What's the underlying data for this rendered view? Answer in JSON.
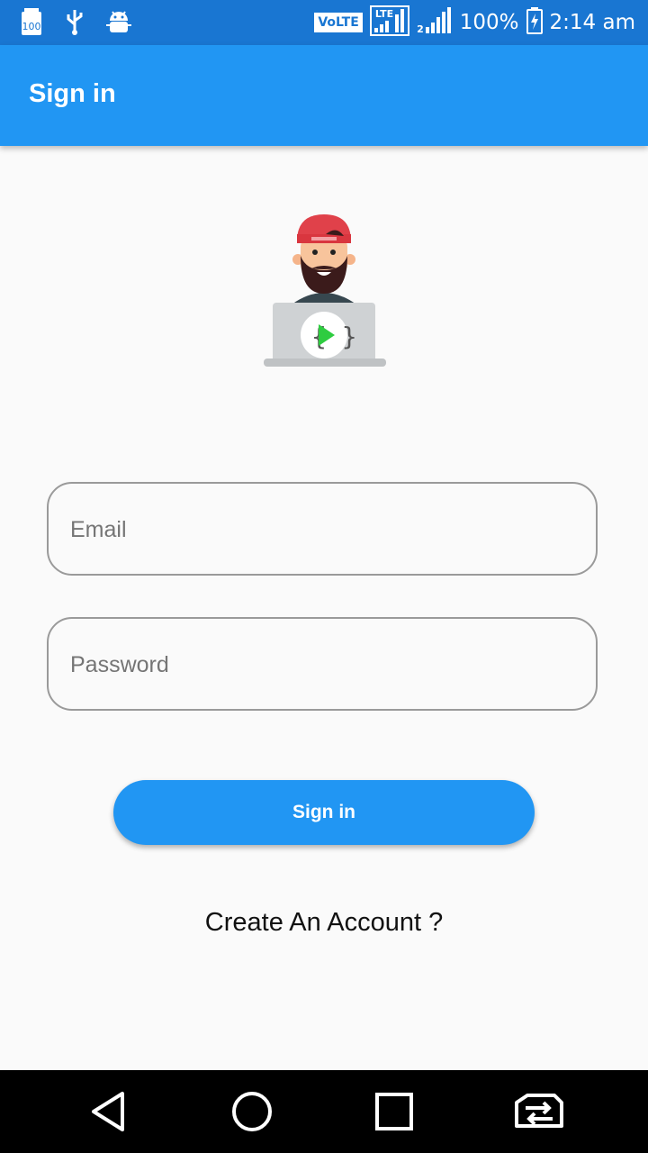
{
  "status_bar": {
    "battery_badge": "100",
    "volte": "VoLTE",
    "lte": "LTE",
    "sim2_label": "2",
    "battery_percent": "100%",
    "time": "2:14 am",
    "icons": [
      "battery-saver-icon",
      "usb-icon",
      "android-debug-icon",
      "lte-signal-icon",
      "signal-icon",
      "battery-charging-icon"
    ]
  },
  "app_bar": {
    "title": "Sign in",
    "color": "#2196f3"
  },
  "logo": {
    "badge_text": "{ }",
    "icon": "coder-avatar-icon"
  },
  "form": {
    "email": {
      "placeholder": "Email",
      "value": ""
    },
    "password": {
      "placeholder": "Password",
      "value": ""
    },
    "signin_label": "Sign in",
    "create_account_label": "Create An Account ?"
  },
  "nav_bar": {
    "icons": [
      "back-icon",
      "home-icon",
      "recents-icon",
      "switch-sim-icon"
    ]
  }
}
